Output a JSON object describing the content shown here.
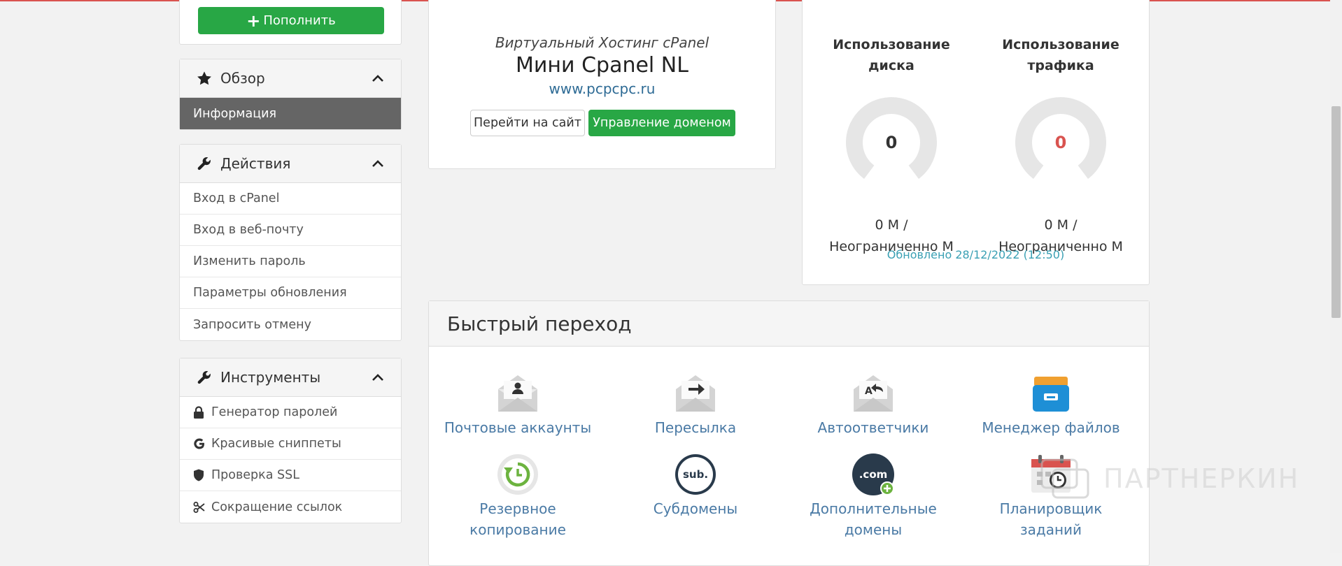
{
  "sidebar": {
    "topup_label": "Пополнить",
    "overview": {
      "title": "Обзор",
      "items": [
        {
          "label": "Информация"
        }
      ]
    },
    "actions": {
      "title": "Действия",
      "items": [
        {
          "label": "Вход в cPanel"
        },
        {
          "label": "Вход в веб-почту"
        },
        {
          "label": "Изменить пароль"
        },
        {
          "label": "Параметры обновления"
        },
        {
          "label": "Запросить отмену"
        }
      ]
    },
    "tools": {
      "title": "Инструменты",
      "items": [
        {
          "label": "Генератор паролей",
          "icon": "lock-icon"
        },
        {
          "label": "Красивые сниппеты",
          "icon": "google-icon"
        },
        {
          "label": "Проверка SSL",
          "icon": "shield-icon"
        },
        {
          "label": "Сокращение ссылок",
          "icon": "scissors-icon"
        }
      ]
    }
  },
  "product": {
    "subtitle": "Виртуальный Хостинг cPanel",
    "name": "Мини Cpanel NL",
    "domain": "www.pcpcpc.ru",
    "visit_label": "Перейти на сайт",
    "manage_label": "Управление доменом"
  },
  "usage": {
    "disk": {
      "title_line1": "Использование",
      "title_line2": "диска",
      "value": "0",
      "amount_line1": "0 M /",
      "amount_line2": "Неограниченно M",
      "fraction": 0
    },
    "traffic": {
      "title_line1": "Использование",
      "title_line2": "трафика",
      "value": "0",
      "amount_line1": "0 M /",
      "amount_line2": "Неограниченно M",
      "fraction": 0
    },
    "updated": "Обновлено 28/12/2022 (12:50)"
  },
  "quick": {
    "title": "Быстрый переход",
    "items": [
      {
        "line1": "Почтовые аккаунты",
        "line2": "",
        "icon": "email-account-icon"
      },
      {
        "line1": "Пересылка",
        "line2": "",
        "icon": "email-forward-icon"
      },
      {
        "line1": "Автоответчики",
        "line2": "",
        "icon": "autoresponder-icon"
      },
      {
        "line1": "Менеджер файлов",
        "line2": "",
        "icon": "file-manager-icon"
      },
      {
        "line1": "Резервное",
        "line2": "копирование",
        "icon": "backup-icon"
      },
      {
        "line1": "Субдомены",
        "line2": "",
        "icon": "subdomain-icon"
      },
      {
        "line1": "Дополнительные",
        "line2": "домены",
        "icon": "addon-domain-icon"
      },
      {
        "line1": "Планировщик",
        "line2": "заданий",
        "icon": "cron-icon"
      }
    ]
  },
  "watermark": {
    "text": "ПАРТНЕРКИН"
  },
  "colors": {
    "green": "#28a745",
    "link": "#4a7aa5",
    "accent_red": "#d9534f",
    "teal": "#3aa0b4"
  }
}
